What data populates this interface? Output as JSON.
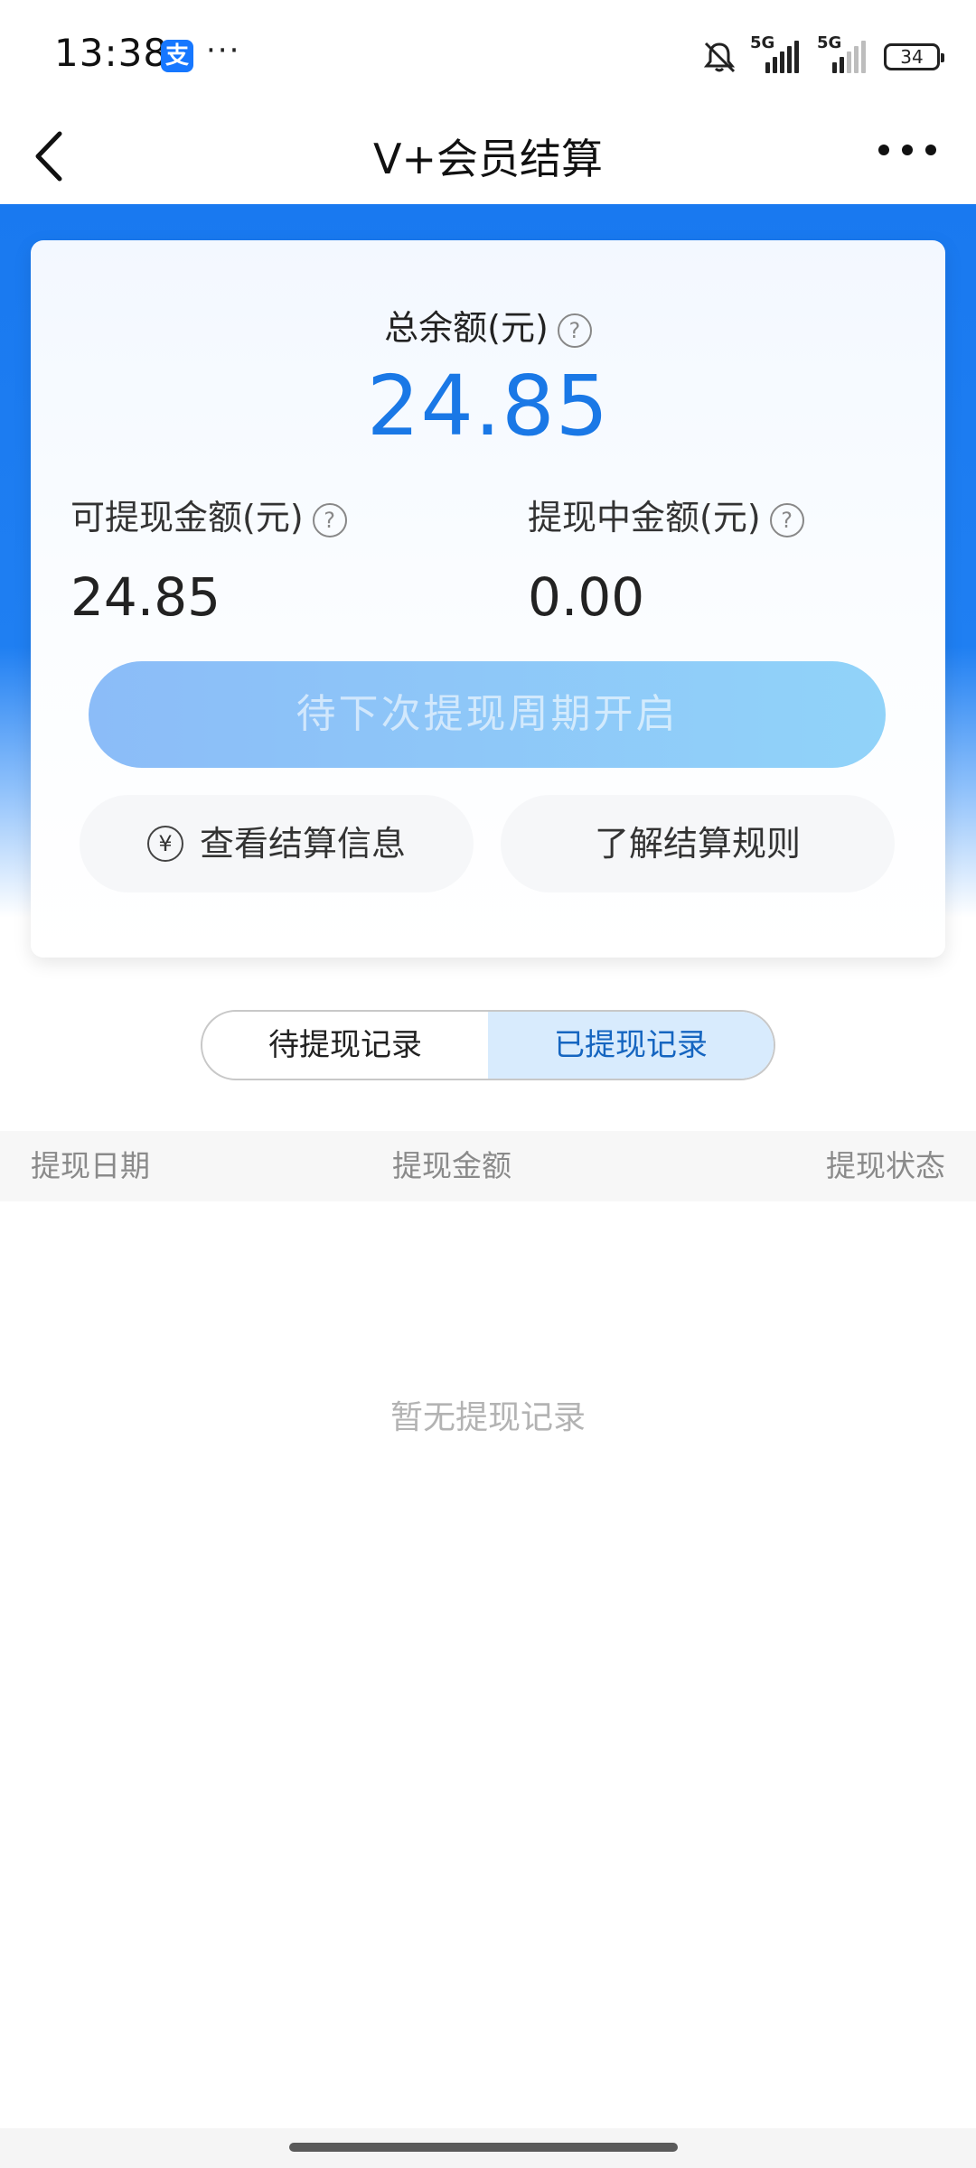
{
  "status_bar": {
    "time": "13:38",
    "app_badge": "支",
    "dots": "···",
    "net1": "5G",
    "net2": "5G",
    "battery": "34"
  },
  "nav": {
    "title": "V+会员结算"
  },
  "summary": {
    "total_label": "总余额(元)",
    "total_value": "24.85",
    "withdrawable_label": "可提现金额(元)",
    "withdrawable_value": "24.85",
    "pending_label": "提现中金额(元)",
    "pending_value": "0.00",
    "help_glyph": "?"
  },
  "actions": {
    "primary_label": "待下次提现周期开启",
    "view_settlement_label": "查看结算信息",
    "rules_label": "了解结算规则",
    "yuan_glyph": "¥"
  },
  "tabs": [
    {
      "label": "待提现记录",
      "active": false
    },
    {
      "label": "已提现记录",
      "active": true
    }
  ],
  "table": {
    "headers": [
      "提现日期",
      "提现金额",
      "提现状态"
    ],
    "empty_text": "暂无提现记录"
  },
  "colors": {
    "brand_blue": "#1979f0",
    "amount_blue": "#1a78e6",
    "active_tab_bg": "#d8ebfd"
  }
}
